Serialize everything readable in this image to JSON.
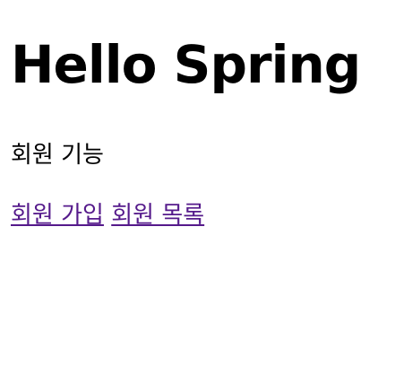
{
  "page": {
    "heading": "Hello Spring",
    "subtitle": "회원 기능",
    "links": [
      {
        "label": "회원 가입"
      },
      {
        "label": "회원 목록"
      }
    ]
  },
  "colors": {
    "text": "#000000",
    "visited_link": "#551a8b",
    "background": "#ffffff"
  }
}
